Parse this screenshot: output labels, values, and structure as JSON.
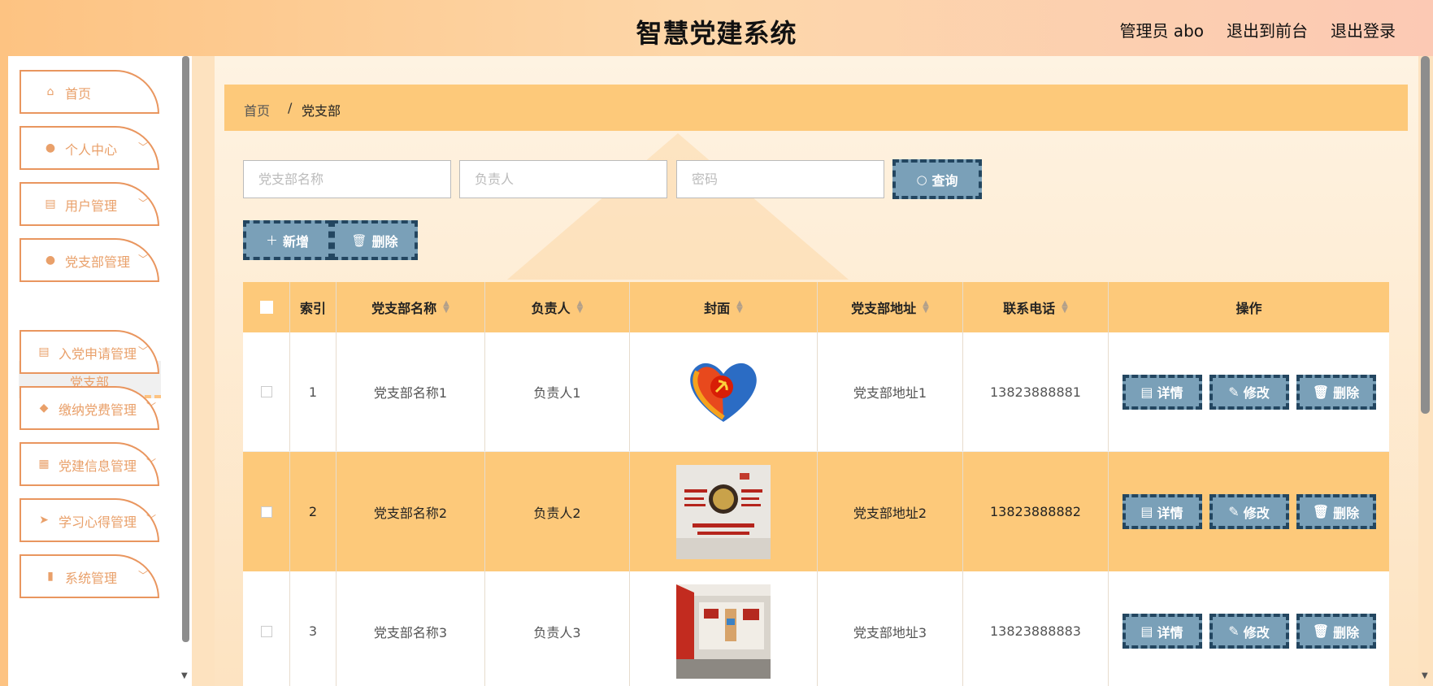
{
  "header": {
    "title": "智慧党建系统",
    "user": "管理员 abo",
    "to_front": "退出到前台",
    "logout": "退出登录"
  },
  "sidebar": {
    "items": [
      {
        "label": "首页",
        "icon": "home-icon"
      },
      {
        "label": "个人中心",
        "icon": "user-icon"
      },
      {
        "label": "用户管理",
        "icon": "clipboard-icon"
      },
      {
        "label": "党支部管理",
        "icon": "user-icon"
      },
      {
        "label": "入党申请管理",
        "icon": "clipboard-icon"
      },
      {
        "label": "缴纳党费管理",
        "icon": "pin-icon"
      },
      {
        "label": "党建信息管理",
        "icon": "grid-icon"
      },
      {
        "label": "学习心得管理",
        "icon": "send-icon"
      },
      {
        "label": "系统管理",
        "icon": "bar-chart-icon"
      }
    ],
    "submenu": {
      "label": "党支部"
    }
  },
  "breadcrumb": {
    "home": "首页",
    "sep": "/",
    "current": "党支部"
  },
  "search": {
    "name_placeholder": "党支部名称",
    "leader_placeholder": "负责人",
    "password_placeholder": "密码",
    "query_label": "查询"
  },
  "actions": {
    "add_label": "新增",
    "delete_label": "删除"
  },
  "table": {
    "headers": [
      "索引",
      "党支部名称",
      "负责人",
      "封面",
      "党支部地址",
      "联系电话",
      "操作"
    ],
    "rows": [
      {
        "index": "1",
        "name": "党支部名称1",
        "leader": "负责人1",
        "address": "党支部地址1",
        "phone": "13823888881"
      },
      {
        "index": "2",
        "name": "党支部名称2",
        "leader": "负责人2",
        "address": "党支部地址2",
        "phone": "13823888882"
      },
      {
        "index": "3",
        "name": "党支部名称3",
        "leader": "负责人3",
        "address": "党支部地址3",
        "phone": "13823888883"
      }
    ],
    "row_actions": {
      "detail": "详情",
      "edit": "修改",
      "delete": "删除"
    }
  },
  "colors": {
    "accent": "#fdc97a",
    "button": "#7aa0b8",
    "button_border": "#234660",
    "menu_text": "#e9a06a"
  }
}
